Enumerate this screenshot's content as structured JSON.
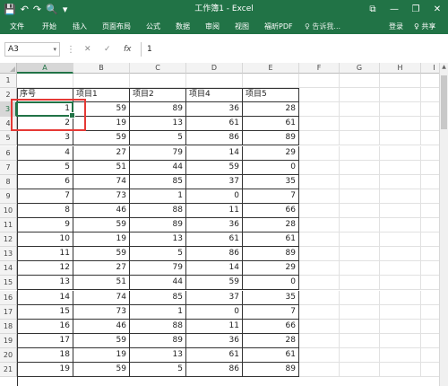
{
  "window": {
    "title": "工作簿1 - Excel",
    "qat": {
      "save": "💾",
      "undo": "↶",
      "redo": "↷",
      "preview": "🔍",
      "customize": "▾"
    },
    "controls": {
      "ribbon_options": "⧉",
      "minimize": "—",
      "restore": "❐",
      "close": "✕"
    }
  },
  "ribbon": {
    "tabs": [
      "文件",
      "开始",
      "插入",
      "页面布局",
      "公式",
      "数据",
      "审阅",
      "视图",
      "福昕PDF"
    ],
    "tell_me": "♀ 告诉我...",
    "login": "登录",
    "share": "♀ 共享"
  },
  "formula_bar": {
    "name_box": "A3",
    "name_box_dropdown": "▾",
    "more": "⋮",
    "cancel": "✕",
    "enter": "✓",
    "fx": "fx",
    "content": "1"
  },
  "sheet": {
    "columns": [
      "A",
      "B",
      "C",
      "D",
      "E",
      "F",
      "G",
      "H",
      "I"
    ],
    "selected_column": "A",
    "selected_row": 3,
    "row_numbers": [
      1,
      2,
      3,
      4,
      5,
      6,
      7,
      8,
      9,
      10,
      11,
      12,
      13,
      14,
      15,
      16,
      17,
      18,
      19,
      20,
      21
    ],
    "headers": [
      "序号",
      "项目1",
      "项目2",
      "项目4",
      "项目5"
    ],
    "data": [
      [
        1,
        59,
        89,
        36,
        28
      ],
      [
        2,
        19,
        13,
        61,
        61
      ],
      [
        3,
        59,
        5,
        86,
        89
      ],
      [
        4,
        27,
        79,
        14,
        29
      ],
      [
        5,
        51,
        44,
        59,
        0
      ],
      [
        6,
        74,
        85,
        37,
        35
      ],
      [
        7,
        73,
        1,
        0,
        7
      ],
      [
        8,
        46,
        88,
        11,
        66
      ],
      [
        9,
        59,
        89,
        36,
        28
      ],
      [
        10,
        19,
        13,
        61,
        61
      ],
      [
        11,
        59,
        5,
        86,
        89
      ],
      [
        12,
        27,
        79,
        14,
        29
      ],
      [
        13,
        51,
        44,
        59,
        0
      ],
      [
        14,
        74,
        85,
        37,
        35
      ],
      [
        15,
        73,
        1,
        0,
        7
      ],
      [
        16,
        46,
        88,
        11,
        66
      ],
      [
        17,
        59,
        89,
        36,
        28
      ],
      [
        18,
        19,
        13,
        61,
        61
      ],
      [
        19,
        59,
        5,
        86,
        89
      ]
    ]
  },
  "scrollbar": {
    "up": "▲"
  },
  "colors": {
    "excel_green": "#217346",
    "highlight_red": "#e53935"
  }
}
